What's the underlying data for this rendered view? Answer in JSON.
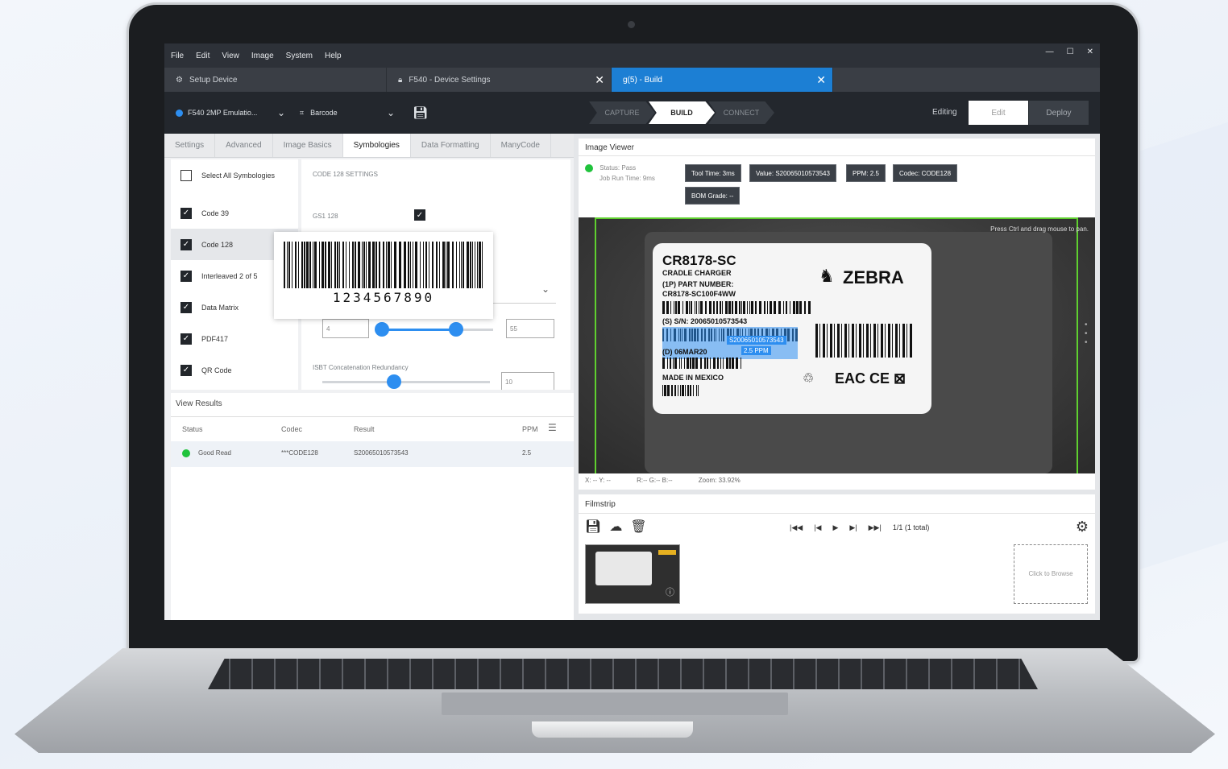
{
  "menu": [
    "File",
    "Edit",
    "View",
    "Image",
    "System",
    "Help"
  ],
  "window_controls": {
    "minimize": "—",
    "maximize": "☐",
    "close": "✕"
  },
  "tabs": [
    {
      "label": "Setup Device",
      "icon": "device-icon"
    },
    {
      "label": "F540 - Device Settings",
      "icon": "lock-icon"
    },
    {
      "label": "g(5) - Build",
      "active": true
    }
  ],
  "toolbar": {
    "device": "F540 2MP Emulatio...",
    "tool": "Barcode",
    "steps": [
      "CAPTURE",
      "BUILD",
      "CONNECT"
    ],
    "active_step": "BUILD",
    "mode_label": "Editing",
    "edit": "Edit",
    "deploy": "Deploy"
  },
  "settings_tabs": [
    "Settings",
    "Advanced",
    "Image Basics",
    "Symbologies",
    "Data Formatting",
    "ManyCode"
  ],
  "symbologies": {
    "select_all": "Select All Symbologies",
    "items": [
      {
        "label": "Code 39",
        "checked": true
      },
      {
        "label": "Code 128",
        "checked": true
      },
      {
        "label": "Interleaved 2 of 5",
        "checked": true
      },
      {
        "label": "Data Matrix",
        "checked": true
      },
      {
        "label": "PDF417",
        "checked": true
      },
      {
        "label": "QR Code",
        "checked": true
      }
    ]
  },
  "code128": {
    "header": "CODE 128 SETTINGS",
    "gs1_label": "GS1 128",
    "min_value": "4",
    "max_value": "55",
    "min_fraction": 0.0,
    "max_fraction": 0.67,
    "concat_label": "ISBT Concatenation Redundancy",
    "concat_value": "10",
    "concat_fraction": 0.43
  },
  "barcode_popup": {
    "digits": "1234567890"
  },
  "results": {
    "title": "View Results",
    "columns": [
      "Status",
      "Codec",
      "Result",
      "PPM"
    ],
    "rows": [
      {
        "status": "Good Read",
        "codec": "***CODE128",
        "result": "S20065010573543",
        "ppm": "2.5"
      }
    ]
  },
  "image_viewer": {
    "title": "Image Viewer",
    "status": "Status: Pass",
    "job_time": "Job Run Time: 9ms",
    "pills": [
      "Tool Time: 3ms",
      "Value: S20065010573543",
      "PPM: 2.5",
      "Codec: CODE128",
      "BOM Grade: --"
    ],
    "hint": "Press Ctrl and drag mouse to pan.",
    "footer_xy": "X: -- Y: --",
    "footer_rgb": "R:-- G:-- B:--",
    "zoom": "Zoom: 33.92%",
    "label": {
      "model": "CR8178-SC",
      "desc": "CRADLE CHARGER",
      "pn_label": "(1P) PART NUMBER:",
      "pn": "CR8178-SC100F4WW",
      "sn": "(S) S/N: 20065010573543",
      "date": "(D) 06MAR20",
      "origin": "MADE IN MEXICO",
      "brand": "ZEBRA",
      "overlay_value": "S20065010573543",
      "overlay_ppm": "2.5 PPM"
    }
  },
  "filmstrip": {
    "title": "Filmstrip",
    "count": "1/1 (1 total)",
    "browse": "Click to Browse"
  }
}
